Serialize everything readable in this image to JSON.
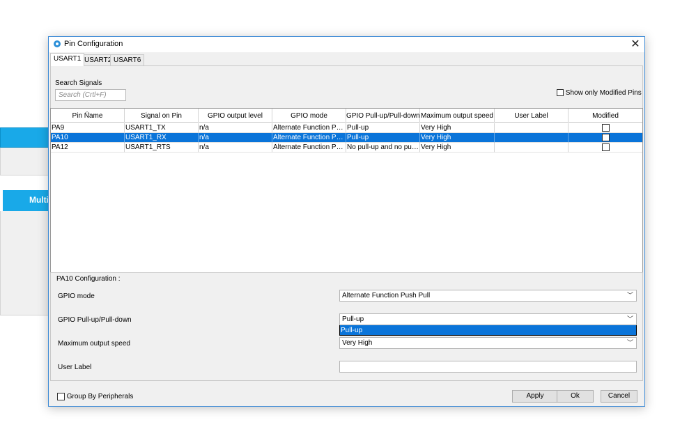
{
  "background": {
    "partial_label": "Multi"
  },
  "dialog": {
    "title": "Pin Configuration",
    "close_glyph": "✕",
    "tabs": [
      {
        "label": "USART1",
        "active": true
      },
      {
        "label": "USART2",
        "active": false
      },
      {
        "label": "USART6",
        "active": false
      }
    ],
    "search": {
      "label": "Search Signals",
      "placeholder": "Search (Crtl+F)"
    },
    "show_modified": {
      "label": "Show only Modified Pins",
      "checked": false
    },
    "table": {
      "columns": [
        "Pin Name",
        "Signal on Pin",
        "GPIO output level",
        "GPIO mode",
        "GPIO Pull-up/Pull-down",
        "Maximum output speed",
        "User Label",
        "Modified"
      ],
      "rows": [
        {
          "pin": "PA9",
          "signal": "USART1_TX",
          "level": "n/a",
          "mode": "Alternate Function Pus...",
          "pull": "Pull-up",
          "speed": "Very High",
          "label": "",
          "modified": false,
          "selected": false
        },
        {
          "pin": "PA10",
          "signal": "USART1_RX",
          "level": "n/a",
          "mode": "Alternate Function Pus...",
          "pull": "Pull-up",
          "speed": "Very High",
          "label": "",
          "modified": false,
          "selected": true
        },
        {
          "pin": "PA12",
          "signal": "USART1_RTS",
          "level": "n/a",
          "mode": "Alternate Function Pus...",
          "pull": "No pull-up and no pull-...",
          "speed": "Very High",
          "label": "",
          "modified": false,
          "selected": false
        }
      ]
    },
    "config": {
      "title": "PA10 Configuration :",
      "fields": {
        "gpio_mode": {
          "label": "GPIO mode",
          "value": "Alternate Function Push Pull"
        },
        "pull": {
          "label": "GPIO Pull-up/Pull-down",
          "value": "Pull-up",
          "open_option": "Pull-up"
        },
        "speed": {
          "label": "Maximum output speed",
          "value": "Very High"
        },
        "user_label": {
          "label": "User Label",
          "value": ""
        }
      }
    },
    "footer": {
      "group_by": {
        "label": "Group By Peripherals",
        "checked": false
      },
      "apply": "Apply",
      "ok": "Ok",
      "cancel": "Cancel"
    }
  },
  "icons": {
    "title": "gear-icon",
    "close": "close-icon",
    "dropdown": "chevron-down-icon",
    "sort": "sort-up-icon"
  },
  "colors": {
    "selection": "#0a74d9",
    "accent": "#19a9e8",
    "dialog_border": "#3c8ad6"
  }
}
